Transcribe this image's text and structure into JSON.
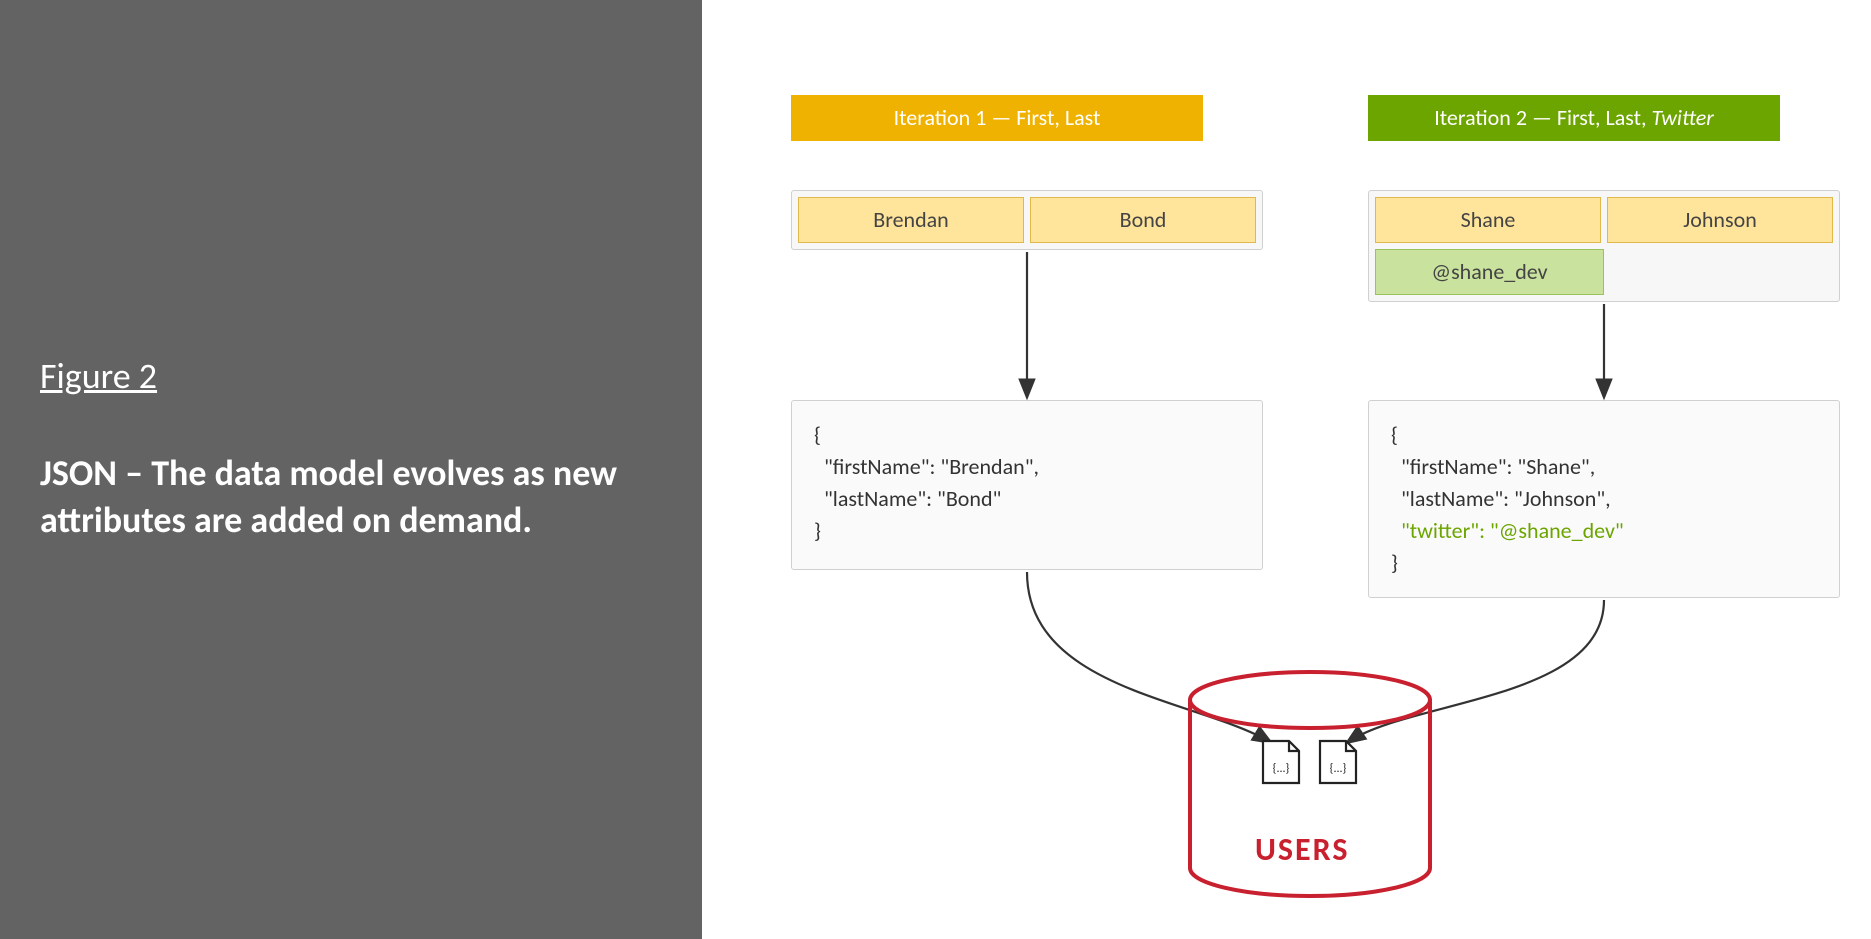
{
  "figure": {
    "label": "Figure 2",
    "description": "JSON – The data model evolves as new attributes are added on demand."
  },
  "iterations": {
    "iter1": {
      "badge_prefix": "Iteration 1 — First, Last",
      "badge_italic": "",
      "first": "Brendan",
      "last": "Bond",
      "json_line1": "{",
      "json_line2": "  \"firstName\": \"Brendan\",",
      "json_line3": "  \"lastName\": \"Bond\"",
      "json_line4": "}"
    },
    "iter2": {
      "badge_prefix": "Iteration 2 — First, Last, ",
      "badge_italic": "Twitter",
      "first": "Shane",
      "last": "Johnson",
      "twitter": "@shane_dev",
      "json_line1": "{",
      "json_line2": "  \"firstName\": \"Shane\",",
      "json_line3": "  \"lastName\": \"Johnson\",",
      "json_line4": "  \"twitter\": \"@shane_dev\"",
      "json_line5": "}"
    }
  },
  "database": {
    "label": "USERS",
    "doc_glyph": "{...}"
  },
  "colors": {
    "orange": "#efb200",
    "green_badge": "#6ca500",
    "yellow_chip": "#ffe49b",
    "green_chip": "#c9e29d",
    "db_red": "#c8202f",
    "panel_gray": "#636363"
  }
}
